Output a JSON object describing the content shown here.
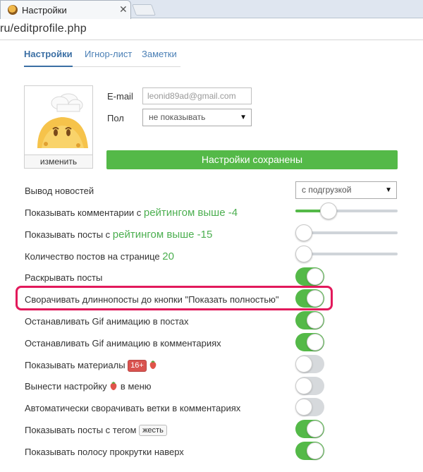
{
  "browser": {
    "tab_title": "Настройки",
    "close_glyph": "✕",
    "address": "ru/editprofile.php"
  },
  "page_tabs": [
    {
      "label": "Настройки",
      "active": true
    },
    {
      "label": "Игнор-лист",
      "active": false
    },
    {
      "label": "Заметки",
      "active": false
    }
  ],
  "avatar": {
    "change_label": "изменить"
  },
  "form": {
    "email_label": "E-mail",
    "email_value": "leonid89ad@gmail.com",
    "gender_label": "Пол",
    "gender_value": "не показывать",
    "saved_message": "Настройки сохранены"
  },
  "settings": {
    "news_output": {
      "label": "Вывод новостей",
      "value": "с подгрузкой"
    },
    "comments_rating": {
      "label": "Показывать комментарии с",
      "strong": "рейтингом выше -4",
      "level": 0.29
    },
    "posts_rating": {
      "label": "Показывать посты с",
      "strong": "рейтингом выше -15",
      "level": 0.0
    },
    "posts_per_page": {
      "label": "Количество постов на странице",
      "strong": "20",
      "level": 0.0
    },
    "toggles": [
      {
        "label": "Раскрывать посты",
        "on": true
      },
      {
        "label": "Сворачивать длиннопосты до кнопки \"Показать полностью\"",
        "on": true,
        "highlighted": true
      },
      {
        "label": "Останавливать Gif анимацию в постах",
        "on": true
      },
      {
        "label": "Останавливать Gif анимацию в комментариях",
        "on": true
      },
      {
        "label": "Показывать материалы",
        "badge": "16+",
        "on": false
      },
      {
        "label_before": "Вынести настройку",
        "label_after": "в меню",
        "on": false
      },
      {
        "label": "Автоматически сворачивать ветки в комментариях",
        "on": false
      },
      {
        "label": "Показывать посты с тегом",
        "tag": "жесть",
        "on": true
      },
      {
        "label": "Показывать полосу прокрутки наверх",
        "on": true
      }
    ]
  },
  "colors": {
    "accent_green": "#54b948",
    "link_blue": "#3b6fa4",
    "highlight_pink": "#e2195b",
    "badge_red": "#d9534f"
  }
}
